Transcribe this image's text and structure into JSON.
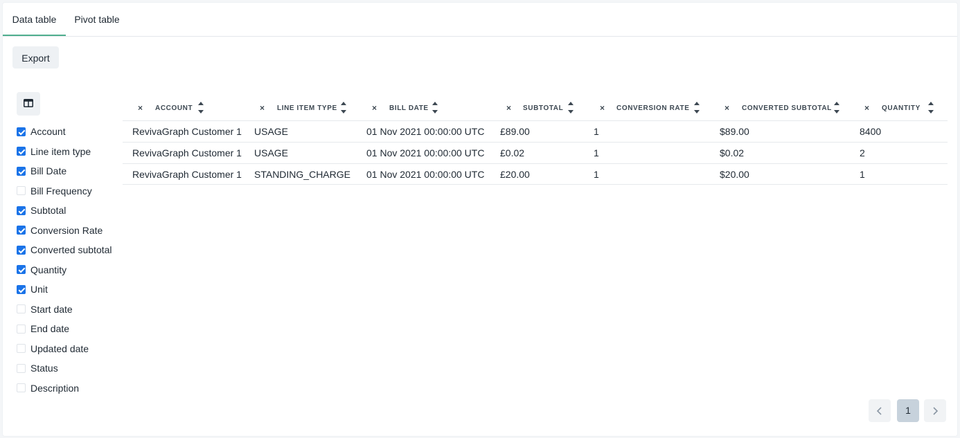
{
  "tabs": [
    {
      "label": "Data table",
      "active": true
    },
    {
      "label": "Pivot table",
      "active": false
    }
  ],
  "toolbar": {
    "export_label": "Export"
  },
  "column_toggle": {
    "icon": "columns-icon"
  },
  "columns_list": [
    {
      "label": "Account",
      "checked": true
    },
    {
      "label": "Line item type",
      "checked": true
    },
    {
      "label": "Bill Date",
      "checked": true
    },
    {
      "label": "Bill Frequency",
      "checked": false
    },
    {
      "label": "Subtotal",
      "checked": true
    },
    {
      "label": "Conversion Rate",
      "checked": true
    },
    {
      "label": "Converted subtotal",
      "checked": true
    },
    {
      "label": "Quantity",
      "checked": true
    },
    {
      "label": "Unit",
      "checked": true
    },
    {
      "label": "Start date",
      "checked": false
    },
    {
      "label": "End date",
      "checked": false
    },
    {
      "label": "Updated date",
      "checked": false
    },
    {
      "label": "Status",
      "checked": false
    },
    {
      "label": "Description",
      "checked": false
    }
  ],
  "table": {
    "headers": [
      "ACCOUNT",
      "LINE ITEM TYPE",
      "BILL DATE",
      "SUBTOTAL",
      "CONVERSION RATE",
      "CONVERTED SUBTOTAL",
      "QUANTITY"
    ],
    "remove_icon": "×",
    "rows": [
      [
        "RevivaGraph Customer 1",
        "USAGE",
        "01 Nov 2021 00:00:00 UTC",
        "£89.00",
        "1",
        "$89.00",
        "8400"
      ],
      [
        "RevivaGraph Customer 1",
        "USAGE",
        "01 Nov 2021 00:00:00 UTC",
        "£0.02",
        "1",
        "$0.02",
        "2"
      ],
      [
        "RevivaGraph Customer 1",
        "STANDING_CHARGE",
        "01 Nov 2021 00:00:00 UTC",
        "£20.00",
        "1",
        "$20.00",
        "1"
      ]
    ]
  },
  "pagination": {
    "current_page": "1"
  },
  "colors": {
    "accent": "#4fae8e",
    "checkbox": "#1a73e8",
    "active_page": "#c7d2dc"
  }
}
